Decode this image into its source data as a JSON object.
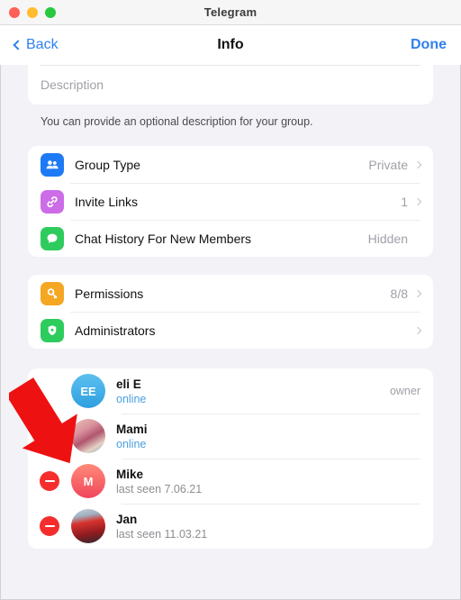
{
  "window": {
    "title": "Telegram",
    "traffic_lights": [
      "close-red",
      "minimize-yellow",
      "maximize-green"
    ]
  },
  "navbar": {
    "back_label": "Back",
    "title": "Info",
    "done_label": "Done"
  },
  "description": {
    "placeholder": "Description",
    "footer": "You can provide an optional description for your group."
  },
  "settings_sections": [
    {
      "rows": [
        {
          "icon": "group-people-icon",
          "icon_color": "#1e7bf5",
          "label": "Group Type",
          "value": "Private",
          "chevron": true
        },
        {
          "icon": "link-icon",
          "icon_color": "#cc6ce7",
          "label": "Invite Links",
          "value": "1",
          "chevron": true
        },
        {
          "icon": "chat-bubble-icon",
          "icon_color": "#2ecc5d",
          "label": "Chat History For New Members",
          "value": "Hidden",
          "chevron": false
        }
      ]
    },
    {
      "rows": [
        {
          "icon": "key-icon",
          "icon_color": "#f5a623",
          "label": "Permissions",
          "value": "8/8",
          "chevron": true
        },
        {
          "icon": "shield-icon",
          "icon_color": "#2ecc5d",
          "label": "Administrators",
          "value": "",
          "chevron": true
        }
      ]
    }
  ],
  "members": [
    {
      "name": "eli E",
      "status": "online",
      "status_online": true,
      "role": "owner",
      "avatar_type": "initials",
      "avatar_initials": "EE",
      "avatar_style": "blue",
      "deletable": false
    },
    {
      "name": "Mami",
      "status": "online",
      "status_online": true,
      "role": "",
      "avatar_type": "photo",
      "avatar_initials": "",
      "avatar_style": "photo-girl",
      "deletable": true
    },
    {
      "name": "Mike",
      "status": "last seen 7.06.21",
      "status_online": false,
      "role": "",
      "avatar_type": "initials",
      "avatar_initials": "M",
      "avatar_style": "pinkred",
      "deletable": true
    },
    {
      "name": "Jan",
      "status": "last seen 11.03.21",
      "status_online": false,
      "role": "",
      "avatar_type": "photo",
      "avatar_initials": "",
      "avatar_style": "photo-car",
      "deletable": true
    }
  ],
  "annotation": {
    "type": "red-arrow",
    "color": "#ee1111",
    "points_to": "delete-member-button-mami"
  },
  "colors": {
    "accent_blue": "#2f80ed",
    "page_background": "#f2f2f7",
    "card_background": "#ffffff",
    "delete_red": "#f52d2d"
  }
}
